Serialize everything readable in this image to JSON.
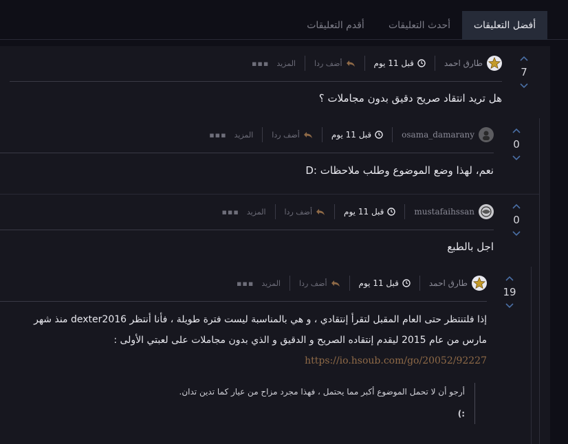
{
  "tabs": [
    {
      "label": "أفضل التعليقات",
      "active": true
    },
    {
      "label": "أحدث التعليقات",
      "active": false
    },
    {
      "label": "أقدم التعليقات",
      "active": false
    }
  ],
  "common": {
    "reply_label": "أضف ردا",
    "more_label": "المزيد"
  },
  "comments": [
    {
      "author": "طارق احمد",
      "time": "قبل 11 يوم",
      "votes": "7",
      "body": "هل تريد انتقاد صريح دقيق بدون مجاملات ؟"
    },
    {
      "author": "osama_damarany",
      "time": "قبل 11 يوم",
      "votes": "0",
      "body": "نعم، لهذا وضع الموضوع وطلب ملاحظات :D"
    },
    {
      "author": "mustafaihssan",
      "time": "قبل 11 يوم",
      "votes": "0",
      "body": "اجل بالطبع"
    },
    {
      "author": "طارق احمد",
      "time": "قبل 11 يوم",
      "votes": "19",
      "body_line1": "إذا فلتنتظر حتى العام المقبل لتقرأ إنتقادي ، و هي بالمناسبة ليست فترة طويلة ، فأنا أنتظر dexter2016 منذ شهر",
      "body_line2": "مارس من عام 2015 ليقدم إنتقاده الصريح و الدقيق و الذي بدون مجاملات على لعبتي الأولى :",
      "link": "https://io.hsoub.com/go/20052/92227",
      "quote_line1": "أرجو أن لا تحمل الموضوع أكبر مما يحتمل ، فهذا مجرد مزاح من عيار كما تدين تدان.",
      "quote_line2": ":)"
    }
  ]
}
